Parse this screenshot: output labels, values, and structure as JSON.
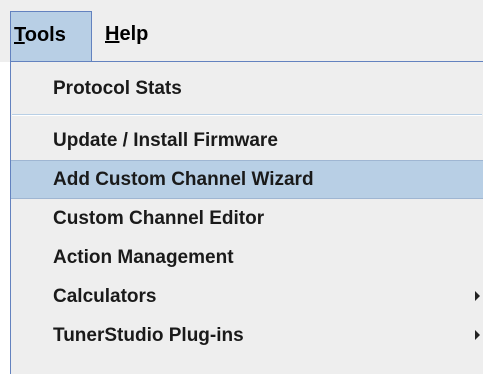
{
  "menubar": {
    "items": [
      {
        "label_mnemonic": "T",
        "label_rest": "ools",
        "state": "open"
      },
      {
        "label_mnemonic": "H",
        "label_rest": "elp",
        "state": "normal"
      }
    ]
  },
  "tools_menu": {
    "items": [
      {
        "label": "Protocol Stats"
      },
      {
        "label": "Update / Install Firmware"
      },
      {
        "label": "Add Custom Channel Wizard",
        "selected": true
      },
      {
        "label": "Custom Channel Editor"
      },
      {
        "label": "Action Management"
      },
      {
        "label": "Calculators",
        "submenu": true,
        "icon": "chevron-right-icon"
      },
      {
        "label": "TunerStudio Plug-ins",
        "submenu": true,
        "icon": "chevron-right-icon"
      }
    ]
  },
  "colors": {
    "selection_background": "#b8cfe5",
    "menu_background": "#eeeeee",
    "border": "#6382bf"
  }
}
